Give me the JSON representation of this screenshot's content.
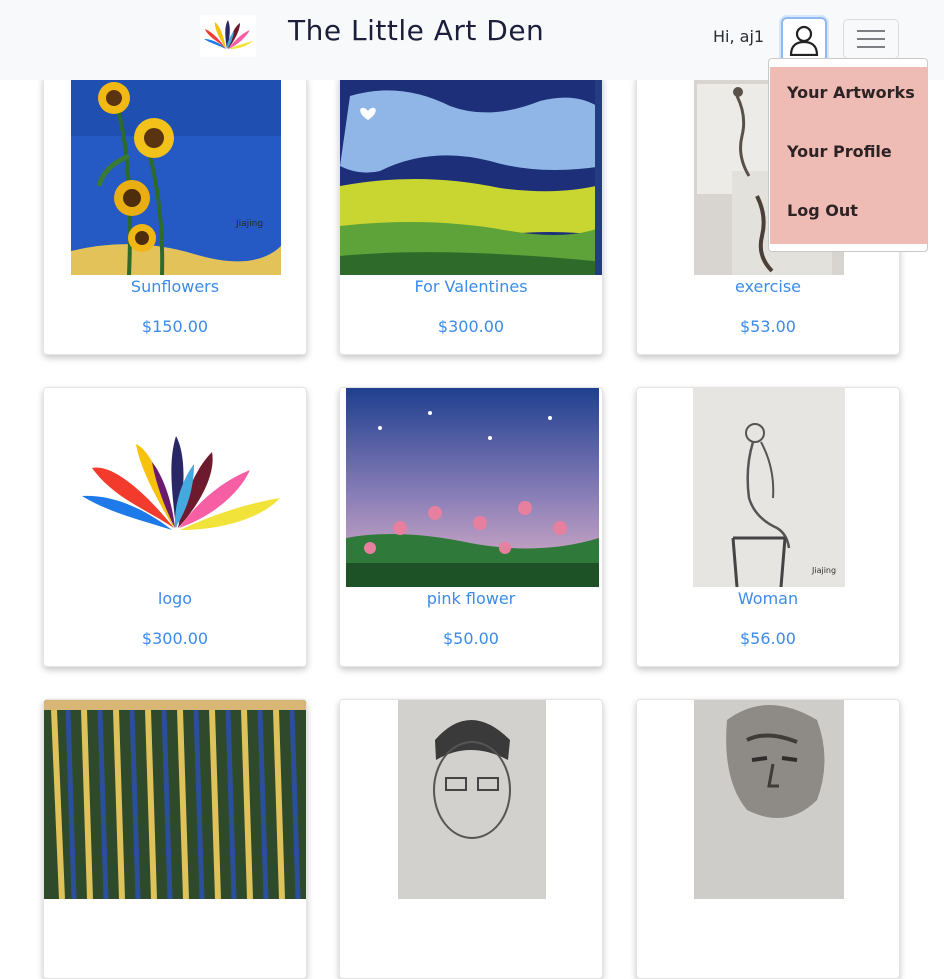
{
  "header": {
    "brand": "The Little Art Den",
    "greeting": "Hi, aj1",
    "logo_icon": "paint-strokes-logo",
    "user_icon": "user-icon",
    "menu_icon": "hamburger-menu-icon"
  },
  "user_menu": {
    "items": [
      "Your Artworks",
      "Your Profile",
      "Log Out"
    ],
    "background": "#efbcb5"
  },
  "artworks": [
    {
      "title": "Sunflowers",
      "price": "$150.00"
    },
    {
      "title": "For Valentines",
      "price": "$300.00"
    },
    {
      "title": "exercise",
      "price": "$53.00"
    },
    {
      "title": "logo",
      "price": "$300.00"
    },
    {
      "title": "pink flower",
      "price": "$50.00"
    },
    {
      "title": "Woman",
      "price": "$56.00"
    },
    {
      "title": "",
      "price": ""
    },
    {
      "title": "",
      "price": ""
    },
    {
      "title": "",
      "price": ""
    }
  ],
  "colors": {
    "link": "#3b8bea",
    "navbar_bg": "#f8f9fa"
  }
}
